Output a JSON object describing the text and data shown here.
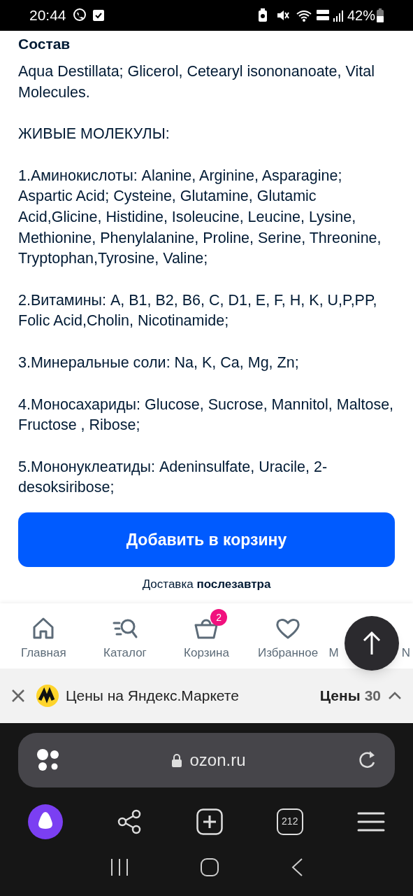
{
  "status_bar": {
    "time": "20:44",
    "battery": "42%"
  },
  "section": {
    "title": "Состав",
    "paragraphs": [
      "Aqua Destillata; Glicerol, Cetearyl isononanoate, Vital Molecules.",
      "ЖИВЫЕ МОЛЕКУЛЫ:",
      "1.Аминокислоты: Alanine, Arginine, Asparagine; Aspartic Acid; Cysteine, Glutamine, Glutamic Acid,Glicine, Histidine, Isoleucine, Leucine, Lysine, Methionine, Phenylalanine, Proline, Serine, Threonine, Tryptophan,Tyrosine, Valine;",
      "2.Витамины: A, B1, B2, B6, C, D1, E, F, H, K, U,P,PP, Folic Acid,Cholin, Nicotinamide;",
      "3.Минеральные соли: Na, K, Ca, Mg, Zn;",
      "4.Моносахариды: Glucose, Sucrose, Mannitol, Maltose, Fructose , Ribose;",
      "5.Мононуклеатиды: Adeninsulfate, Uracile, 2-desoksiribose;"
    ]
  },
  "add_to_cart": "Добавить в корзину",
  "delivery": "Доставка **послезавтра**",
  "bottom_nav": [
    {
      "kind": "home",
      "label": "Главная"
    },
    {
      "kind": "catalog",
      "label": "Каталог"
    },
    {
      "kind": "cart",
      "label": "Корзина",
      "badge": "2"
    },
    {
      "kind": "favorites",
      "label": "Избранное"
    },
    {
      "label_start": "М",
      "label_end": "N"
    }
  ],
  "yandex_bar": {
    "text": "Цены на Яндекс.Маркете",
    "prices_label": "Цены",
    "prices_count": "30"
  },
  "browser": {
    "url": "ozon.ru",
    "tabs_count": "212"
  }
}
